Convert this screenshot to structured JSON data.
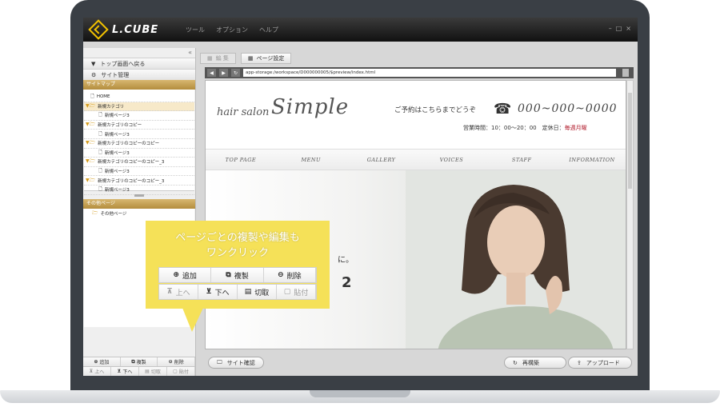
{
  "app": {
    "logo": "L.CUBE",
    "menu": [
      "ツール",
      "オプション",
      "ヘルプ"
    ],
    "window_controls": [
      "–",
      "□",
      "×"
    ]
  },
  "sidebar": {
    "collapse": "«",
    "top_button": "トップ画面へ戻る",
    "site_button": "サイト管理",
    "sitemap_head": "サイトマップ",
    "tree": [
      {
        "label": "HOME",
        "type": "page",
        "level": 0
      },
      {
        "label": "新規カテゴリ",
        "type": "folder",
        "level": 0,
        "selected": true
      },
      {
        "label": "新規ページ3",
        "type": "page",
        "level": 1
      },
      {
        "label": "新規カテゴリのコピー",
        "type": "folder",
        "level": 0
      },
      {
        "label": "新規ページ3",
        "type": "page",
        "level": 1
      },
      {
        "label": "新規カテゴリのコピーのコピー",
        "type": "folder",
        "level": 0
      },
      {
        "label": "新規ページ3",
        "type": "page",
        "level": 1
      },
      {
        "label": "新規カテゴリのコピーのコピー_3",
        "type": "folder",
        "level": 0
      },
      {
        "label": "新規ページ3",
        "type": "page",
        "level": 1
      },
      {
        "label": "新規カテゴリのコピーのコピー_3",
        "type": "folder",
        "level": 0
      },
      {
        "label": "新規ページ3",
        "type": "page",
        "level": 1
      }
    ],
    "other_head": "その他ページ",
    "other_items": [
      "その他ページ"
    ],
    "actions_row1": [
      "追加",
      "複製",
      "削除"
    ],
    "actions_row2": [
      "上へ",
      "下へ",
      "切取",
      "貼付"
    ]
  },
  "toolbar": {
    "edit": "編 集",
    "page_settings": "ページ設定"
  },
  "urlbar": {
    "url": "app-storage:/workspace/D000000005/$preview/index.html"
  },
  "preview": {
    "brand_small": "hair salon",
    "brand_big": "Simple",
    "reserve": "ご予約はこちらまでどうぞ",
    "phone": "000~000~0000",
    "hours_label": "営業時間：10：00～20：00　定休日：",
    "closed": "毎週月曜",
    "nav": [
      "TOP PAGE",
      "MENU",
      "GALLERY",
      "VOICES",
      "STAFF",
      "INFORMATION"
    ],
    "hero_text1": "に。",
    "hero_text2": "2"
  },
  "bottombar": {
    "site_check": "サイト確認",
    "rebuild": "再構築",
    "upload": "アップロード"
  },
  "callout": {
    "line1": "ページごとの複製や編集も",
    "line2": "ワンクリック",
    "row1": [
      "追加",
      "複製",
      "削除"
    ],
    "row2": [
      "上へ",
      "下へ",
      "切取",
      "貼付"
    ]
  }
}
